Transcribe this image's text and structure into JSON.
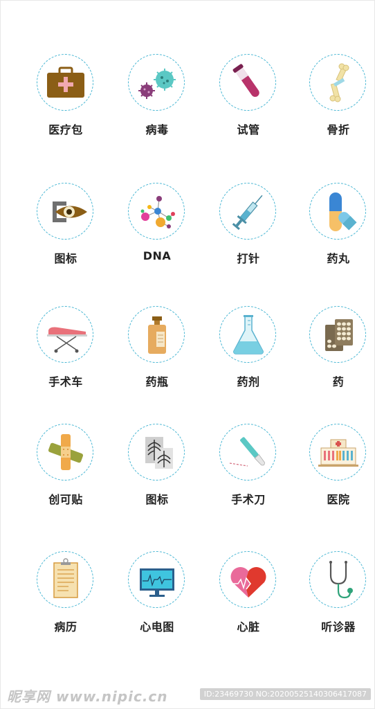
{
  "icons": [
    {
      "label": "医疗包",
      "icon": "first-aid-kit-icon"
    },
    {
      "label": "病毒",
      "icon": "virus-icon"
    },
    {
      "label": "试管",
      "icon": "test-tube-icon"
    },
    {
      "label": "骨折",
      "icon": "bone-fracture-icon"
    },
    {
      "label": "图标",
      "icon": "eye-icon"
    },
    {
      "label": "DNA",
      "icon": "dna-molecule-icon"
    },
    {
      "label": "打针",
      "icon": "syringe-icon"
    },
    {
      "label": "药丸",
      "icon": "capsule-icon"
    },
    {
      "label": "手术车",
      "icon": "surgical-cart-icon"
    },
    {
      "label": "药瓶",
      "icon": "medicine-bottle-icon"
    },
    {
      "label": "药剂",
      "icon": "flask-icon"
    },
    {
      "label": "药",
      "icon": "pill-blister-icon"
    },
    {
      "label": "创可贴",
      "icon": "bandage-icon"
    },
    {
      "label": "图标",
      "icon": "xray-icon"
    },
    {
      "label": "手术刀",
      "icon": "scalpel-icon"
    },
    {
      "label": "医院",
      "icon": "hospital-icon"
    },
    {
      "label": "病历",
      "icon": "medical-record-icon"
    },
    {
      "label": "心电图",
      "icon": "ecg-monitor-icon"
    },
    {
      "label": "心脏",
      "icon": "broken-heart-icon"
    },
    {
      "label": "听诊器",
      "icon": "stethoscope-icon"
    }
  ],
  "watermark": {
    "logo": "昵享网 www.nipic.cn",
    "id_text": "ID:23469730 NO:20200525140306417087"
  },
  "colors": {
    "circle_border": "#47b6d3",
    "label_text": "#222222"
  }
}
